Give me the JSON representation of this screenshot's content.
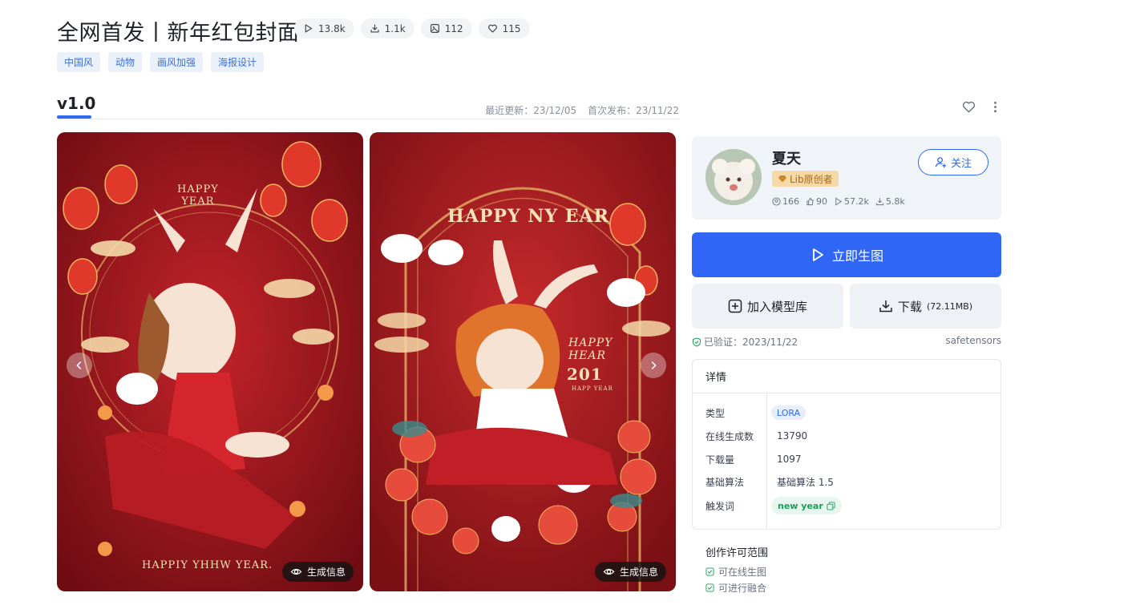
{
  "title": "全网首发丨新年红包封面",
  "stats": [
    {
      "icon": "play-icon",
      "value": "13.8k"
    },
    {
      "icon": "download-icon",
      "value": "1.1k"
    },
    {
      "icon": "image-icon",
      "value": "112"
    },
    {
      "icon": "heart-icon",
      "value": "115"
    }
  ],
  "tags": [
    "中国风",
    "动物",
    "画风加强",
    "海报设计"
  ],
  "version": {
    "label": "v1.0",
    "updated": "最近更新：23/12/05",
    "published": "首次发布：23/11/22"
  },
  "images": [
    {
      "text_top": "HAPPY\nYEAR",
      "text_bottom": "HAPPIY YHHW YEAR.",
      "gen_info": "生成信息"
    },
    {
      "text_top": "HAPPY NY EAR",
      "text_mid": "HAPPY HEAR",
      "text_year": "201",
      "text_small": "HAPP YEAR",
      "gen_info": "生成信息"
    }
  ],
  "creator": {
    "name": "夏天",
    "badge": "Lib原创者",
    "follow_label": "关注",
    "stats": [
      {
        "icon": "user-icon",
        "value": "166"
      },
      {
        "icon": "thumb-icon",
        "value": "90"
      },
      {
        "icon": "play-icon",
        "value": "57.2k"
      },
      {
        "icon": "download-icon",
        "value": "5.8k"
      }
    ]
  },
  "actions": {
    "run_label": "立即生图",
    "add_label": "加入模型库",
    "download_label": "下载",
    "download_size": "(72.11MB)"
  },
  "verify": {
    "label": "已验证：2023/11/22",
    "format": "safetensors"
  },
  "details": {
    "title": "详情",
    "rows": [
      {
        "key": "类型",
        "value": "LORA"
      },
      {
        "key": "在线生成数",
        "value": "13790"
      },
      {
        "key": "下载量",
        "value": "1097"
      },
      {
        "key": "基础算法",
        "value": "基础算法 1.5"
      },
      {
        "key": "触发词",
        "value": "new year"
      }
    ]
  },
  "license": {
    "title": "创作许可范围",
    "items": [
      "可在线生图",
      "可进行融合"
    ]
  },
  "colors": {
    "accent": "#3066f5",
    "tag_bg": "#eaf1fb",
    "tag_text": "#3d6ed8",
    "image_red": "#a8141c",
    "trigger_green": "#18a058"
  }
}
